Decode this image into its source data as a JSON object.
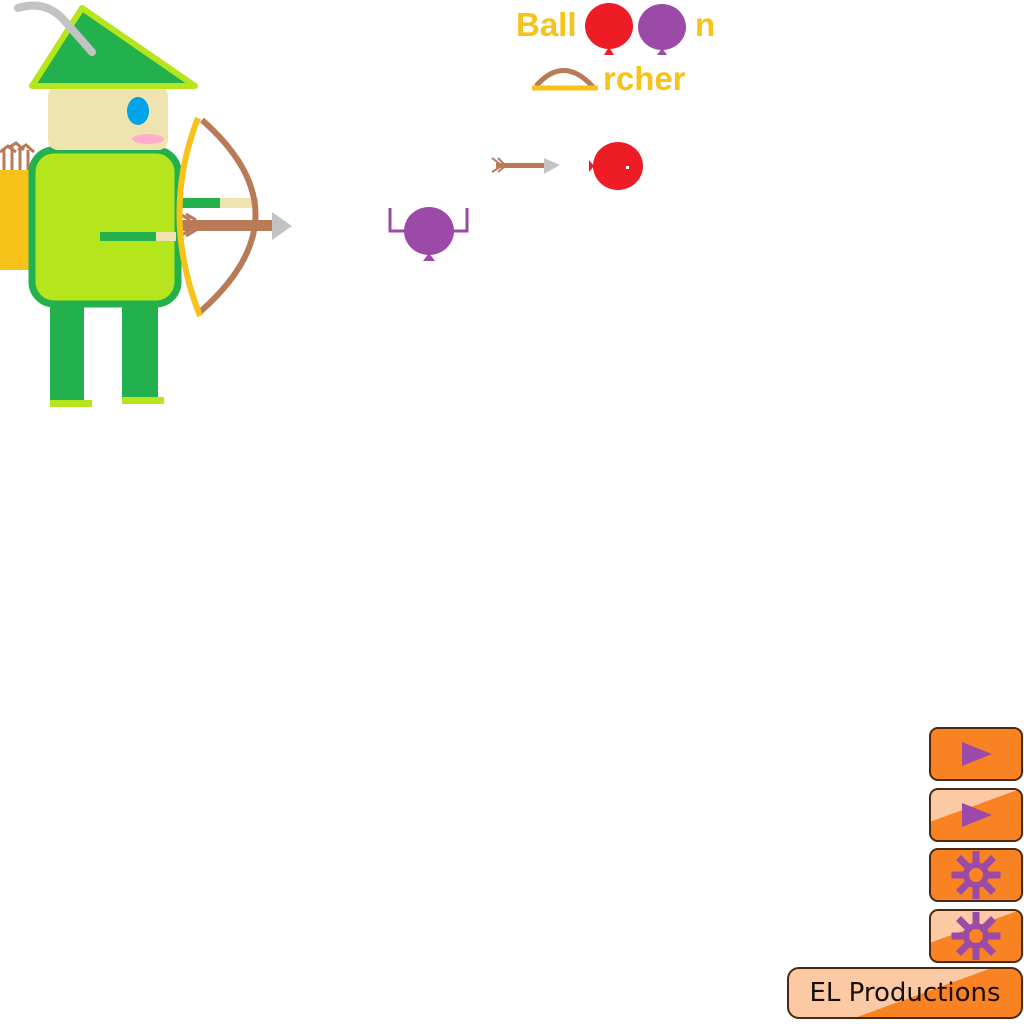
{
  "title": {
    "line1_prefix": "Ball",
    "line1_suffix": "n",
    "line2": "rcher"
  },
  "menu": {
    "buttons": [
      {
        "icon": "play-icon",
        "style": "solid"
      },
      {
        "icon": "play-icon",
        "style": "light"
      },
      {
        "icon": "gear-icon",
        "style": "solid"
      },
      {
        "icon": "gear-icon",
        "style": "light"
      }
    ],
    "credit_label": "EL Productions"
  },
  "colors": {
    "title": "#f7c21a",
    "button": "#f98322",
    "button_light": "#fbc9a3",
    "icon": "#9b4aa8",
    "balloon_red": "#ee1c24",
    "balloon_purple": "#9b4aa8",
    "archer_tunic": "#b5e61d",
    "archer_green": "#22b14c",
    "bow": "#b97a57",
    "bowstring": "#f7c21a"
  }
}
